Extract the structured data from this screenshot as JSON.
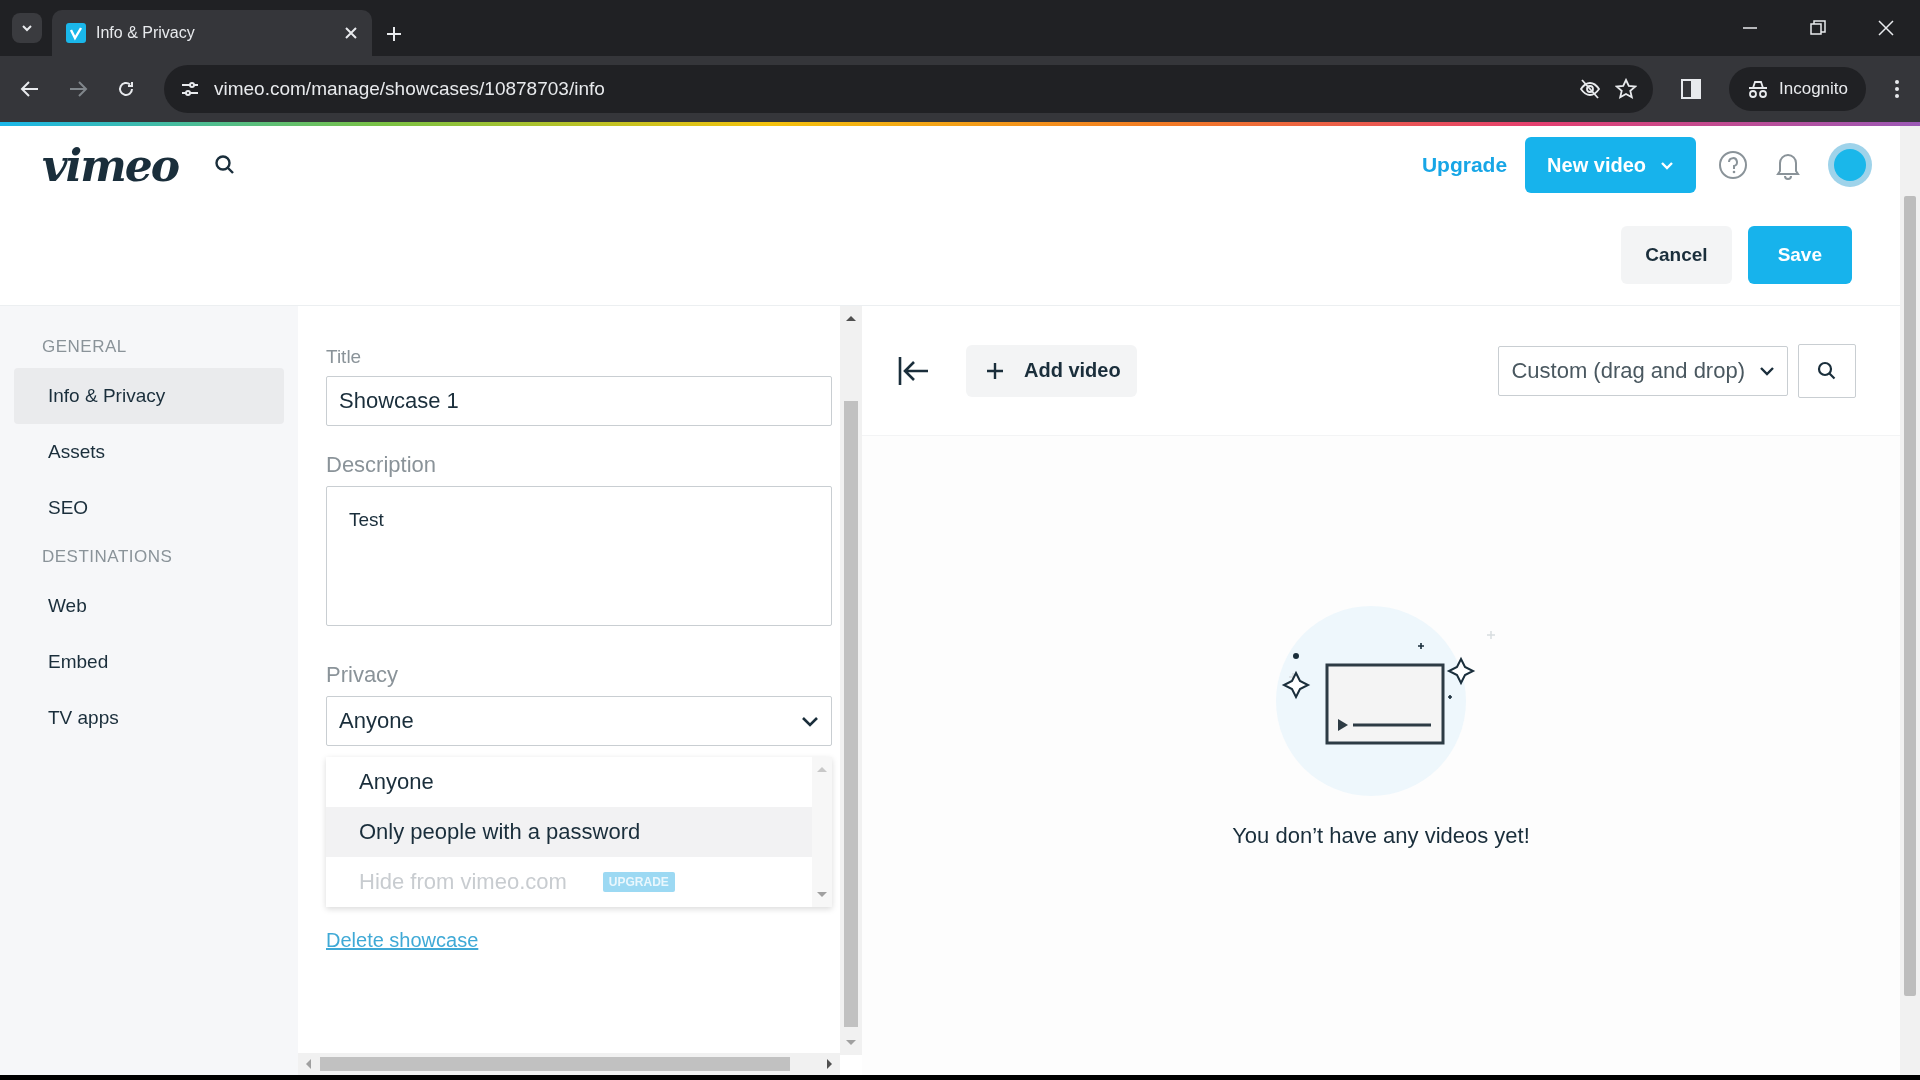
{
  "browser": {
    "tab_title": "Info & Privacy",
    "url": "vimeo.com/manage/showcases/10878703/info",
    "profile_label": "Incognito"
  },
  "header": {
    "logo": "vimeo",
    "upgrade_link": "Upgrade",
    "new_video_button": "New video",
    "cancel_button": "Cancel",
    "save_button": "Save"
  },
  "sidebar": {
    "sections": [
      {
        "heading": "GENERAL",
        "items": [
          {
            "label": "Info & Privacy",
            "selected": true
          },
          {
            "label": "Assets",
            "selected": false
          },
          {
            "label": "SEO",
            "selected": false
          }
        ]
      },
      {
        "heading": "DESTINATIONS",
        "items": [
          {
            "label": "Web",
            "selected": false
          },
          {
            "label": "Embed",
            "selected": false
          },
          {
            "label": "TV apps",
            "selected": false
          }
        ]
      }
    ]
  },
  "form": {
    "title_label": "Title",
    "title_value": "Showcase 1",
    "description_label": "Description",
    "description_value": "Test",
    "privacy_label": "Privacy",
    "privacy_value": "Anyone",
    "privacy_options": [
      {
        "label": "Anyone",
        "highlighted": false,
        "disabled": false
      },
      {
        "label": "Only people with a password",
        "highlighted": true,
        "disabled": false
      },
      {
        "label": "Hide from vimeo.com",
        "highlighted": false,
        "disabled": true,
        "badge": "UPGRADE"
      }
    ],
    "delete_link": "Delete showcase"
  },
  "videos": {
    "add_video_button": "Add video",
    "sort_value": "Custom (drag and drop)",
    "empty_text": "You don’t have any videos yet!"
  }
}
